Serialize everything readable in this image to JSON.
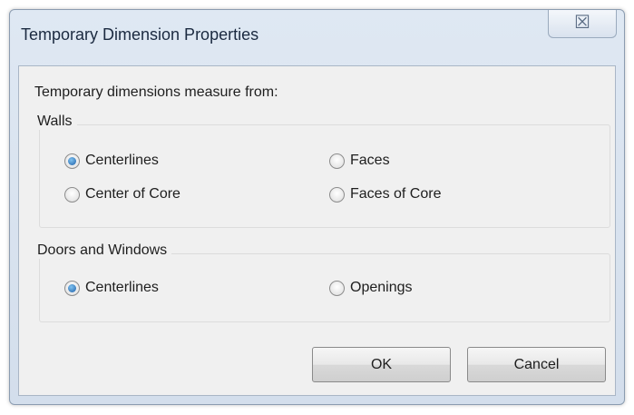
{
  "window": {
    "title": "Temporary Dimension Properties",
    "close_glyph": "☒"
  },
  "intro_text": "Temporary dimensions measure from:",
  "walls": {
    "legend": "Walls",
    "options": [
      {
        "label": "Centerlines",
        "checked": true
      },
      {
        "label": "Faces",
        "checked": false
      },
      {
        "label": "Center of Core",
        "checked": false
      },
      {
        "label": "Faces of Core",
        "checked": false
      }
    ]
  },
  "doors_windows": {
    "legend": "Doors and Windows",
    "options": [
      {
        "label": "Centerlines",
        "checked": true
      },
      {
        "label": "Openings",
        "checked": false
      }
    ]
  },
  "buttons": {
    "ok": "OK",
    "cancel": "Cancel"
  }
}
